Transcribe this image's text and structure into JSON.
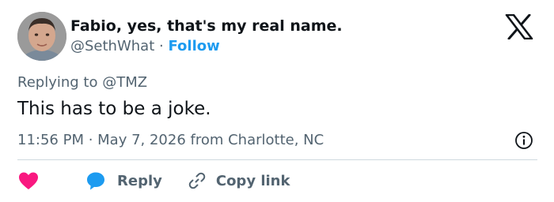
{
  "user": {
    "display_name": "Fabio, yes, that's my real name.",
    "handle": "@SethWhat",
    "separator": "·",
    "follow_label": "Follow"
  },
  "tweet": {
    "replying_to_label": "Replying to @TMZ",
    "text": "This has to be a joke.",
    "meta": "11:56 PM · May 7, 2026 from Charlotte, NC"
  },
  "actions": {
    "reply_label": "Reply",
    "copy_link_label": "Copy link"
  },
  "icons": {
    "brand": "x-logo-icon",
    "info": "info-icon",
    "like": "heart-icon",
    "reply": "speech-bubble-icon",
    "copy_link": "link-icon"
  },
  "colors": {
    "accent": "#1d9bf0",
    "like": "#f91880",
    "text_primary": "#0f1419",
    "text_secondary": "#536471",
    "divider": "#cfd9de"
  }
}
